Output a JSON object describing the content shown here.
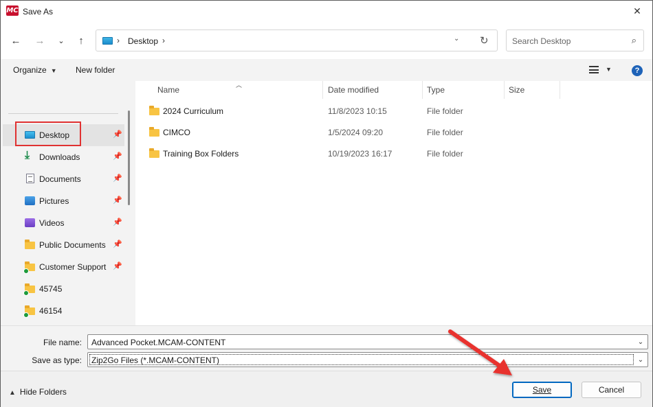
{
  "window": {
    "title": "Save As",
    "app_icon_text": "MC"
  },
  "nav": {
    "address_crumb": "Desktop",
    "search_placeholder": "Search Desktop"
  },
  "toolbar": {
    "organize": "Organize",
    "new_folder": "New folder",
    "help": "?"
  },
  "sidebar": {
    "items": [
      {
        "label": "Desktop",
        "icon": "desktop-icon",
        "pinned": true,
        "selected": true
      },
      {
        "label": "Downloads",
        "icon": "download-icon",
        "pinned": true
      },
      {
        "label": "Documents",
        "icon": "documents-icon",
        "pinned": true
      },
      {
        "label": "Pictures",
        "icon": "pictures-icon",
        "pinned": true
      },
      {
        "label": "Videos",
        "icon": "videos-icon",
        "pinned": true
      },
      {
        "label": "Public Documents",
        "icon": "folder-icon",
        "pinned": true
      },
      {
        "label": "Customer Support",
        "icon": "folder-synced-icon",
        "pinned": true
      },
      {
        "label": "45745",
        "icon": "folder-synced-icon",
        "pinned": false
      },
      {
        "label": "46154",
        "icon": "folder-synced-icon",
        "pinned": false
      }
    ]
  },
  "columns": {
    "name": "Name",
    "date": "Date modified",
    "type": "Type",
    "size": "Size"
  },
  "files": [
    {
      "name": "2024 Curriculum",
      "date": "11/8/2023 10:15",
      "type": "File folder"
    },
    {
      "name": "CIMCO",
      "date": "1/5/2024 09:20",
      "type": "File folder"
    },
    {
      "name": "Training Box Folders",
      "date": "10/19/2023 16:17",
      "type": "File folder"
    }
  ],
  "fields": {
    "file_name_label": "File name:",
    "file_name_value": "Advanced Pocket.MCAM-CONTENT",
    "save_type_label": "Save as type:",
    "save_type_value": "Zip2Go Files (*.MCAM-CONTENT)"
  },
  "footer": {
    "hide_folders": "Hide Folders",
    "save": "Save",
    "cancel": "Cancel"
  },
  "colors": {
    "accent": "#0067c0",
    "highlight": "#e03131",
    "folder": "#f8c443"
  }
}
